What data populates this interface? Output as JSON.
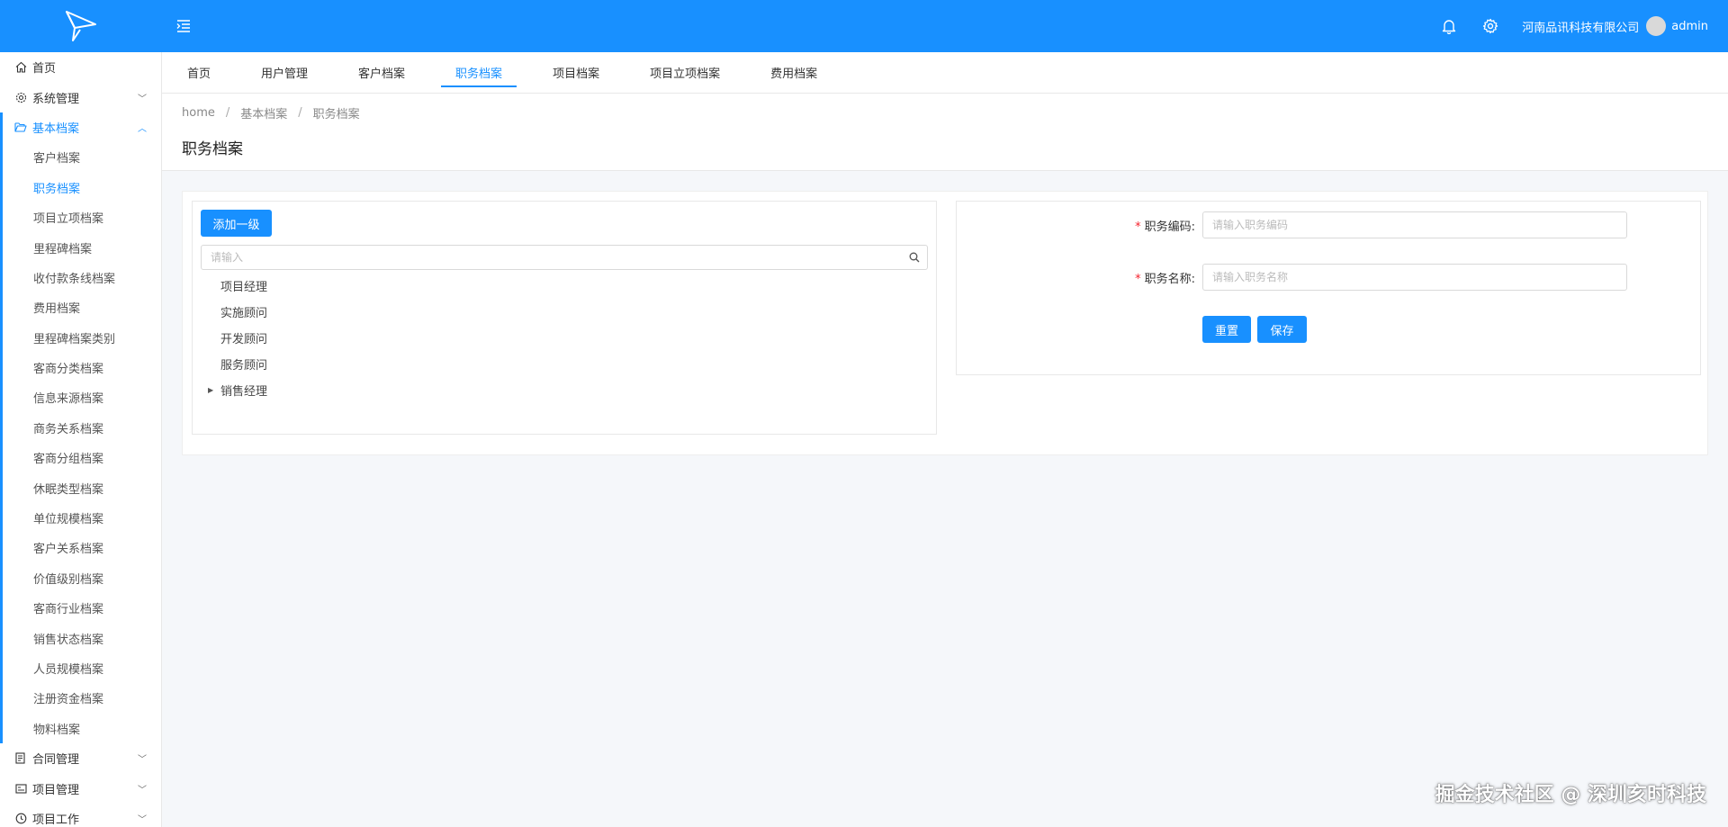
{
  "colors": {
    "primary": "#1890ff",
    "required": "#f5222d"
  },
  "header": {
    "logo_icon": "paper-plane-logo",
    "menu_toggle_icon": "menu-fold-icon",
    "bell_icon": "bell-icon",
    "settings_icon": "gear-icon",
    "company": "河南品讯科技有限公司",
    "username": "admin"
  },
  "sidebar": {
    "home": "首页",
    "system": "系统管理",
    "basic": "基本档案",
    "basic_items": [
      "客户档案",
      "职务档案",
      "项目立项档案",
      "里程碑档案",
      "收付款条线档案",
      "费用档案",
      "里程碑档案类别",
      "客商分类档案",
      "信息来源档案",
      "商务关系档案",
      "客商分组档案",
      "休眠类型档案",
      "单位规模档案",
      "客户关系档案",
      "价值级别档案",
      "客商行业档案",
      "销售状态档案",
      "人员规模档案",
      "注册资金档案",
      "物料档案"
    ],
    "contract": "合同管理",
    "project": "项目管理",
    "project_work": "项目工作"
  },
  "tabs": [
    "首页",
    "用户管理",
    "客户档案",
    "职务档案",
    "项目档案",
    "项目立项档案",
    "费用档案"
  ],
  "breadcrumb": {
    "home": "home",
    "sep": "/",
    "level1": "基本档案",
    "level2": "职务档案"
  },
  "page_title": "职务档案",
  "left": {
    "add_button": "添加一级",
    "search_placeholder": "请输入",
    "tree": [
      "项目经理",
      "实施顾问",
      "开发顾问",
      "服务顾问",
      "销售经理"
    ]
  },
  "form": {
    "code_label": "职务编码:",
    "code_placeholder": "请输入职务编码",
    "name_label": "职务名称:",
    "name_placeholder": "请输入职务名称",
    "required_mark": "*",
    "reset": "重置",
    "save": "保存"
  },
  "watermark": "掘金技术社区 @ 深圳亥时科技"
}
